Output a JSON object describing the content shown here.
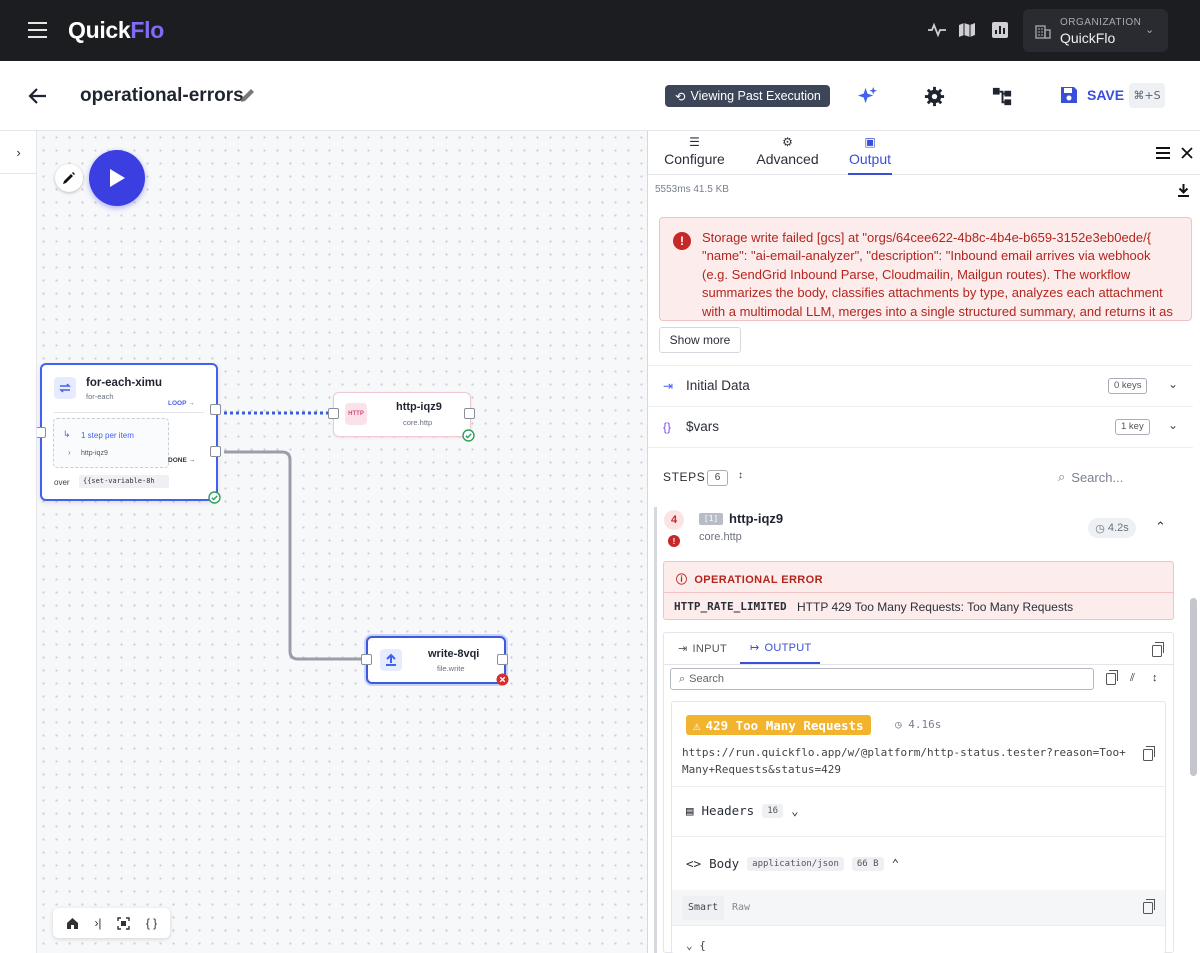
{
  "app": {
    "logo_part1": "Quick",
    "logo_part2": "Flo",
    "accent": "#3a4fd8",
    "topbar_bg": "#1c1d21"
  },
  "topbar": {
    "icons": [
      "activity-icon",
      "map-icon",
      "chart-icon"
    ],
    "org_label": "ORGANIZATION",
    "org_name": "QuickFlo"
  },
  "header": {
    "workflow_name": "operational-errors",
    "viewing_badge": "Viewing Past Execution",
    "save_label": "SAVE",
    "save_shortcut": "⌘+S"
  },
  "canvas": {
    "nodes": {
      "for_each": {
        "title": "for-each-ximu",
        "subtitle": "for-each",
        "loop_label": "LOOP →",
        "inner_label": "1 step per item",
        "inner_child": "http-iqz9",
        "done_label": "DONE →",
        "over_label": "over",
        "over_value": "{{set-variable-8h"
      },
      "http": {
        "title": "http-iqz9",
        "subtitle": "core.http",
        "icon_text": "HTTP"
      },
      "write": {
        "title": "write-8vqi",
        "subtitle": "file.write"
      }
    }
  },
  "panel": {
    "tabs": [
      {
        "label": "Configure",
        "icon": "sliders-icon"
      },
      {
        "label": "Advanced",
        "icon": "gear-icon"
      },
      {
        "label": "Output",
        "icon": "terminal-icon",
        "active": true
      }
    ],
    "meta": "5553ms  41.5 KB",
    "error_message": "Storage write failed [gcs] at \"orgs/64cee622-4b8c-4b4e-b659-3152e3eb0ede/{ \"name\": \"ai-email-analyzer\", \"description\": \"Inbound email arrives via webhook (e.g. SendGrid Inbound Parse, Cloudmailin, Mailgun routes). The workflow summarizes the body, classifies attachments by type, analyzes each attachment with a multimodal LLM, merges into a single structured summary, and returns it as",
    "show_more": "Show more",
    "initial_data": {
      "label": "Initial Data",
      "badge": "0 keys"
    },
    "vars": {
      "label": "$vars",
      "badge": "1 key"
    },
    "steps": {
      "label": "STEPS",
      "count": "6",
      "search_placeholder": "Search..."
    },
    "step": {
      "number": "4",
      "icon_text": "[1]",
      "name": "http-iqz9",
      "type": "core.http",
      "duration": "4.2s",
      "error_heading": "OPERATIONAL ERROR",
      "error_code": "HTTP_RATE_LIMITED",
      "error_text": "HTTP 429 Too Many Requests: Too Many Requests",
      "io_tabs": {
        "input": "INPUT",
        "output": "OUTPUT"
      },
      "search_placeholder": "Search",
      "response": {
        "status": "429 Too Many Requests",
        "time": "4.16s",
        "url": "https://run.quickflo.app/w/@platform/http-status.tester?reason=Too+Many+Requests&status=429",
        "headers_label": "Headers",
        "headers_count": "16",
        "body_label": "Body",
        "body_type": "application/json",
        "body_size": "66 B",
        "view_smart": "Smart",
        "view_raw": "Raw",
        "brace": "{"
      }
    }
  }
}
